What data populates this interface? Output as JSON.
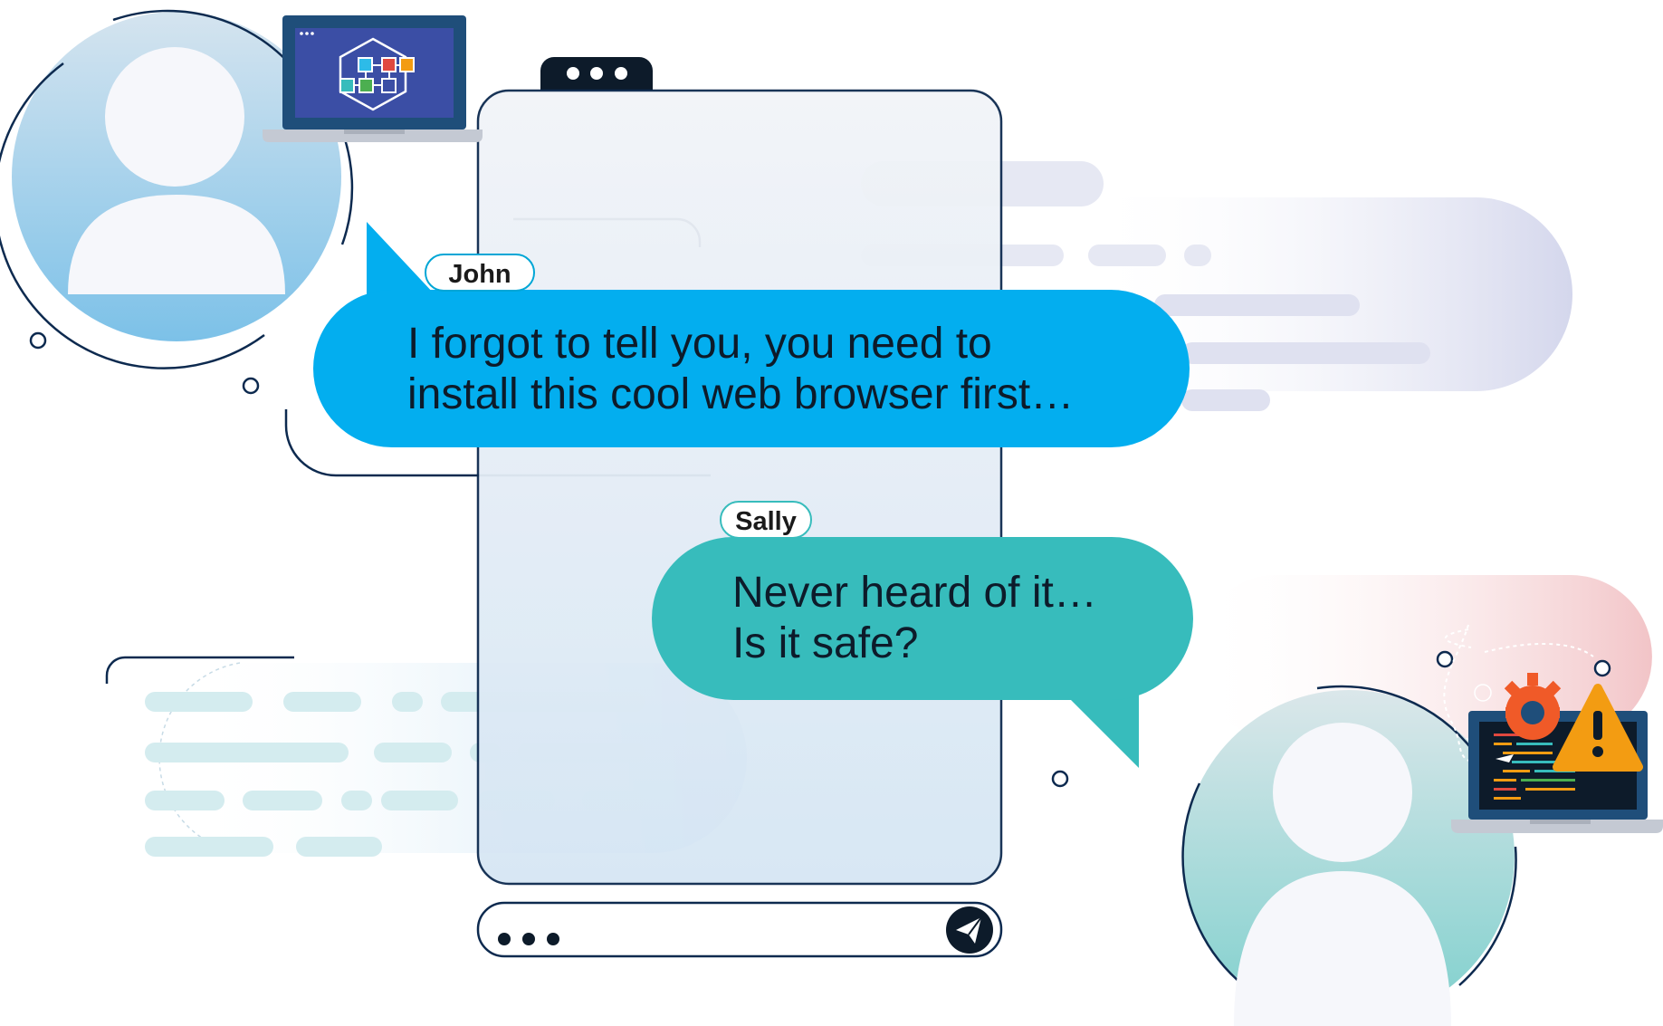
{
  "messages": [
    {
      "sender": "John",
      "lines": [
        "I forgot to tell you, you need to",
        "install this cool web browser first…"
      ],
      "color": "#03aeef"
    },
    {
      "sender": "Sally",
      "lines": [
        "Never heard of it…",
        "Is it safe?"
      ],
      "color": "#37bcbc"
    }
  ],
  "icons": {
    "phone_menu": "three-dots-icon",
    "composer_typing": "typing-dots-icon",
    "send": "send-paper-plane-icon",
    "warning": "warning-triangle-icon",
    "gear": "gear-icon",
    "network": "network-diagram-icon"
  },
  "colors": {
    "dark_navy": "#0d2a4f",
    "accent_blue": "#03aeef",
    "accent_teal": "#37bcbc",
    "warning_orange": "#f39c12",
    "gear_orange": "#f05a28"
  }
}
